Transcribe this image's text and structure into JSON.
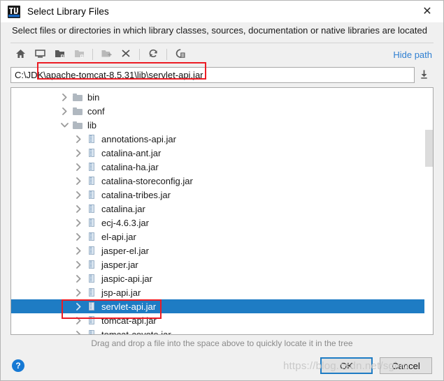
{
  "window": {
    "title": "Select Library Files",
    "app_icon": "intellij-idea-icon",
    "close_label": "✕"
  },
  "header": {
    "description": "Select files or directories in which library classes, sources, documentation or native libraries are located"
  },
  "toolbar": {
    "buttons": [
      {
        "name": "home-icon",
        "title": "Home"
      },
      {
        "name": "desktop-icon",
        "title": "Desktop"
      },
      {
        "name": "project-folder-icon",
        "title": "Project"
      },
      {
        "name": "module-folder-icon",
        "title": "Module",
        "disabled": true
      },
      {
        "name": "new-folder-icon",
        "title": "New Folder"
      },
      {
        "name": "delete-icon",
        "title": "Delete"
      },
      {
        "name": "refresh-icon",
        "title": "Refresh"
      },
      {
        "name": "show-hidden-icon",
        "title": "Show Hidden Files"
      }
    ],
    "hide_path_label": "Hide path"
  },
  "path_field": {
    "value": "C:\\JDK\\apache-tomcat-8.5.31\\lib\\servlet-api.jar",
    "placeholder": "",
    "drop_icon": "download-arrow-icon"
  },
  "tree": {
    "rows": [
      {
        "label": "bin",
        "indent": 0,
        "icon": "folder",
        "expander": "collapsed",
        "selected": false
      },
      {
        "label": "conf",
        "indent": 0,
        "icon": "folder",
        "expander": "collapsed",
        "selected": false
      },
      {
        "label": "lib",
        "indent": 0,
        "icon": "folder",
        "expander": "expanded",
        "selected": false
      },
      {
        "label": "annotations-api.jar",
        "indent": 1,
        "icon": "jar",
        "expander": "collapsed",
        "selected": false
      },
      {
        "label": "catalina-ant.jar",
        "indent": 1,
        "icon": "jar",
        "expander": "collapsed",
        "selected": false
      },
      {
        "label": "catalina-ha.jar",
        "indent": 1,
        "icon": "jar",
        "expander": "collapsed",
        "selected": false
      },
      {
        "label": "catalina-storeconfig.jar",
        "indent": 1,
        "icon": "jar",
        "expander": "collapsed",
        "selected": false
      },
      {
        "label": "catalina-tribes.jar",
        "indent": 1,
        "icon": "jar",
        "expander": "collapsed",
        "selected": false
      },
      {
        "label": "catalina.jar",
        "indent": 1,
        "icon": "jar",
        "expander": "collapsed",
        "selected": false
      },
      {
        "label": "ecj-4.6.3.jar",
        "indent": 1,
        "icon": "jar",
        "expander": "collapsed",
        "selected": false
      },
      {
        "label": "el-api.jar",
        "indent": 1,
        "icon": "jar",
        "expander": "collapsed",
        "selected": false
      },
      {
        "label": "jasper-el.jar",
        "indent": 1,
        "icon": "jar",
        "expander": "collapsed",
        "selected": false
      },
      {
        "label": "jasper.jar",
        "indent": 1,
        "icon": "jar",
        "expander": "collapsed",
        "selected": false
      },
      {
        "label": "jaspic-api.jar",
        "indent": 1,
        "icon": "jar",
        "expander": "collapsed",
        "selected": false
      },
      {
        "label": "jsp-api.jar",
        "indent": 1,
        "icon": "jar",
        "expander": "collapsed",
        "selected": false
      },
      {
        "label": "servlet-api.jar",
        "indent": 1,
        "icon": "jar",
        "expander": "collapsed",
        "selected": true
      },
      {
        "label": "tomcat-api.jar",
        "indent": 1,
        "icon": "jar",
        "expander": "collapsed",
        "selected": false
      },
      {
        "label": "tomcat-coyote.jar",
        "indent": 1,
        "icon": "jar",
        "expander": "collapsed",
        "selected": false
      }
    ],
    "scrollbar": {
      "thumb_top_pct": 17,
      "thumb_height_pct": 15
    }
  },
  "hint": {
    "text": "Drag and drop a file into the space above to quickly locate it in the tree"
  },
  "bottom": {
    "help_label": "?",
    "ok_label": "OK",
    "cancel_label": "Cancel"
  },
  "watermark": {
    "text": "https://blog.csdn.net/sgino"
  },
  "colors": {
    "selection_blue": "#1e7cc4",
    "link_blue": "#2f7fd1",
    "annotation_red": "#ec1c24",
    "dialog_bg": "#f0f0f0"
  }
}
